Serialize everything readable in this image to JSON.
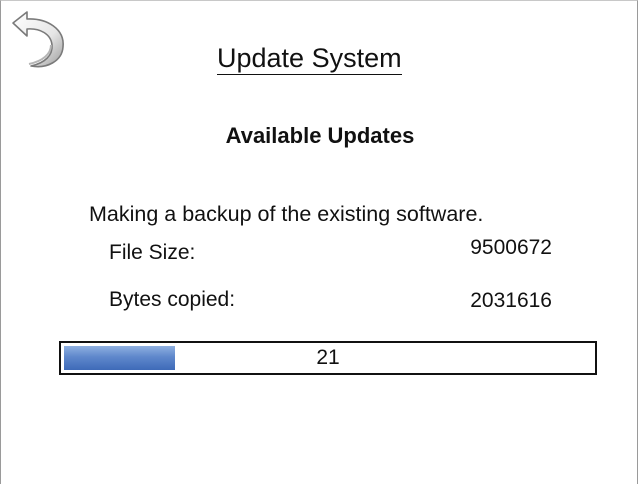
{
  "header": {
    "back_icon": "back-arrow-icon",
    "title": "Update System"
  },
  "main": {
    "subtitle": "Available Updates",
    "status_text": "Making a backup of the existing software.",
    "file_size_label": "File Size:",
    "file_size_value": "9500672",
    "bytes_copied_label": "Bytes copied:",
    "bytes_copied_value": "2031616",
    "progress": {
      "label": "21",
      "percent": 21
    }
  },
  "colors": {
    "progress_fill": "#5f88cc",
    "border": "#111111"
  }
}
